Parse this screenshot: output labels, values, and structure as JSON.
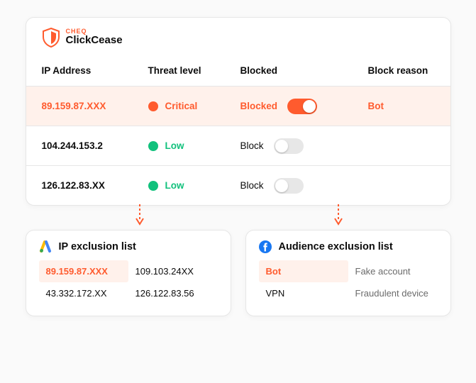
{
  "brand": {
    "super": "CHEQ",
    "name": "ClickCease"
  },
  "table": {
    "headers": {
      "ip": "IP Address",
      "threat": "Threat level",
      "blocked": "Blocked",
      "reason": "Block reason"
    },
    "rows": [
      {
        "ip": "89.159.87.XXX",
        "threat_level": "Critical",
        "blocked_label": "Blocked",
        "blocked_on": true,
        "reason": "Bot"
      },
      {
        "ip": "104.244.153.2",
        "threat_level": "Low",
        "blocked_label": "Block",
        "blocked_on": false,
        "reason": ""
      },
      {
        "ip": "126.122.83.XX",
        "threat_level": "Low",
        "blocked_label": "Block",
        "blocked_on": false,
        "reason": ""
      }
    ]
  },
  "ip_exclusion": {
    "title": "IP exclusion list",
    "items": [
      {
        "v": "89.159.87.XXX",
        "highlight": true
      },
      {
        "v": "109.103.24XX",
        "highlight": false
      },
      {
        "v": "43.332.172.XX",
        "highlight": false
      },
      {
        "v": "126.122.83.56",
        "highlight": false
      }
    ]
  },
  "audience_exclusion": {
    "title": "Audience exclusion list",
    "items": [
      {
        "v": "Bot",
        "highlight": true
      },
      {
        "v": "Fake account",
        "highlight": false
      },
      {
        "v": "VPN",
        "highlight": false
      },
      {
        "v": "Fraudulent device",
        "highlight": false
      }
    ]
  }
}
